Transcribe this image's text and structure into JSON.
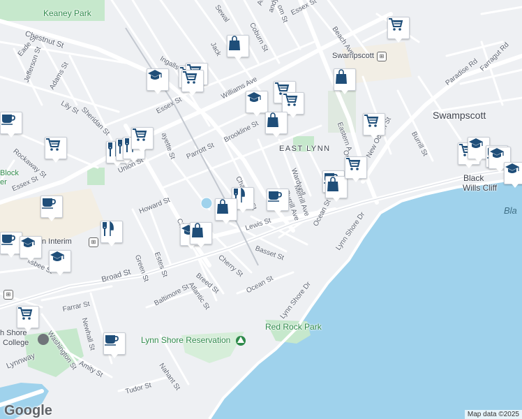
{
  "map": {
    "colors": {
      "land": "#eef0f3",
      "water": "#9fd2ec",
      "park": "#c6e8cc",
      "road": "#ffffff",
      "major_road": "#ffffff",
      "icon": "#1f4e79"
    },
    "place_labels": {
      "swampscott": "Swampscott",
      "east_lynn": "EAST LYNN",
      "black_wills_cliff_1": "Black",
      "black_wills_cliff_2": "Wills Cliff",
      "bla": "Bla",
      "keaney_park": "Keaney Park",
      "red_rock_park": "Red Rock Park",
      "lynn_shore_reservation": "Lynn Shore Reservation",
      "swampscott_station": "Swampscott",
      "lynn_interim": "n Interim",
      "college_1": "h Shore",
      "college_2": "College",
      "block_1": "Block",
      "block_2": "er"
    },
    "street_labels": {
      "chestnut_st": "Chestnut St",
      "essex_st_top": "Essex St",
      "essex_st_mid": "Essex St",
      "essex_st_left": "Essex St",
      "eade_st": "Eade St",
      "jefferson_st": "Jefferson St",
      "adams_st": "Adams St",
      "lily_st": "Lily St",
      "sheridan_st": "Sheridan St",
      "rockaway_st": "Rockaway St",
      "ingalls_st": "Ingalls St",
      "union_st": "Union St",
      "fayette_st": "ayette St",
      "parrott_st": "Parrott St",
      "brookline_st": "Brookline St",
      "williams_ave": "Williams Ave",
      "tirrell_st": "Ti",
      "chatham_st": "Chatham St",
      "wardwell_st": "Wardwell",
      "merrill_ave": "Merrill Ave",
      "burrill_ave": "Burrill Ave",
      "eastern_ave": "Eastern A",
      "new_ocean_st": "New Ocean St",
      "burrill_st": "Burrill St",
      "paradise_rd": "Paradise Rd",
      "farragut_rd": "Farragut Rd",
      "beach_ave": "Beach Ave",
      "coburn_st": "Coburn St",
      "sewall": "Sewal",
      "jackson": "Jack",
      "howard_st": "Howard St",
      "green_st": "Green St",
      "estes_st": "Estes St",
      "lewis_st": "Lewis St",
      "basset_st": "Basset St",
      "cherry_st": "Cherry St",
      "breed_st": "Breed St",
      "atlantic_st": "Atlantic St",
      "broad_st": "Broad St",
      "ocean_st_1": "Ocean St",
      "ocean_st_2": "Ocean St",
      "lynn_shore_dr_1": "Lynn Shore Dr",
      "lynn_shore_dr_2": "Lynn Shore Dr",
      "baltimore_st": "Baltimore St",
      "farrar_st": "Farrar St",
      "newhall_st": "Newhall St",
      "washington_st": "Washington St",
      "amity_st": "Amity St",
      "nahant_st": "Nahant St",
      "tudor_st": "Tudor St",
      "lynnway": "Lynnway",
      "lisbee": "lisbee St",
      "chatham_lower": "Ch",
      "ave": "Ave",
      "andy_rd": "andy Rd",
      "om_st": "om St",
      "ocean_st_short": "On"
    },
    "poi_icons": [
      "school-icon",
      "shopping-cart-icon",
      "shopping-cart-icon",
      "shopping-cart-icon",
      "shopping-bag-icon",
      "shopping-cart-icon",
      "shopping-bag-icon",
      "school-icon",
      "shopping-cart-icon",
      "shopping-cart-icon",
      "shopping-bag-icon",
      "shopping-cart-icon",
      "shopping-cart-icon",
      "restaurant-icon",
      "restaurant-icon",
      "restaurant-icon",
      "shopping-cart-icon",
      "coffee-icon",
      "coffee-icon",
      "coffee-icon",
      "school-icon",
      "school-icon",
      "restaurant-icon",
      "restaurant-icon",
      "shopping-bag-icon",
      "school-icon",
      "shopping-bag-icon",
      "coffee-icon",
      "coffee-icon",
      "shopping-bag-icon",
      "shopping-cart-icon",
      "shopping-cart-icon",
      "school-icon",
      "coffee-icon",
      "school-icon",
      "shopping-cart-icon",
      "coffee-icon"
    ],
    "branding": {
      "logo": "Google",
      "attribution": "Map data ©2025"
    }
  }
}
